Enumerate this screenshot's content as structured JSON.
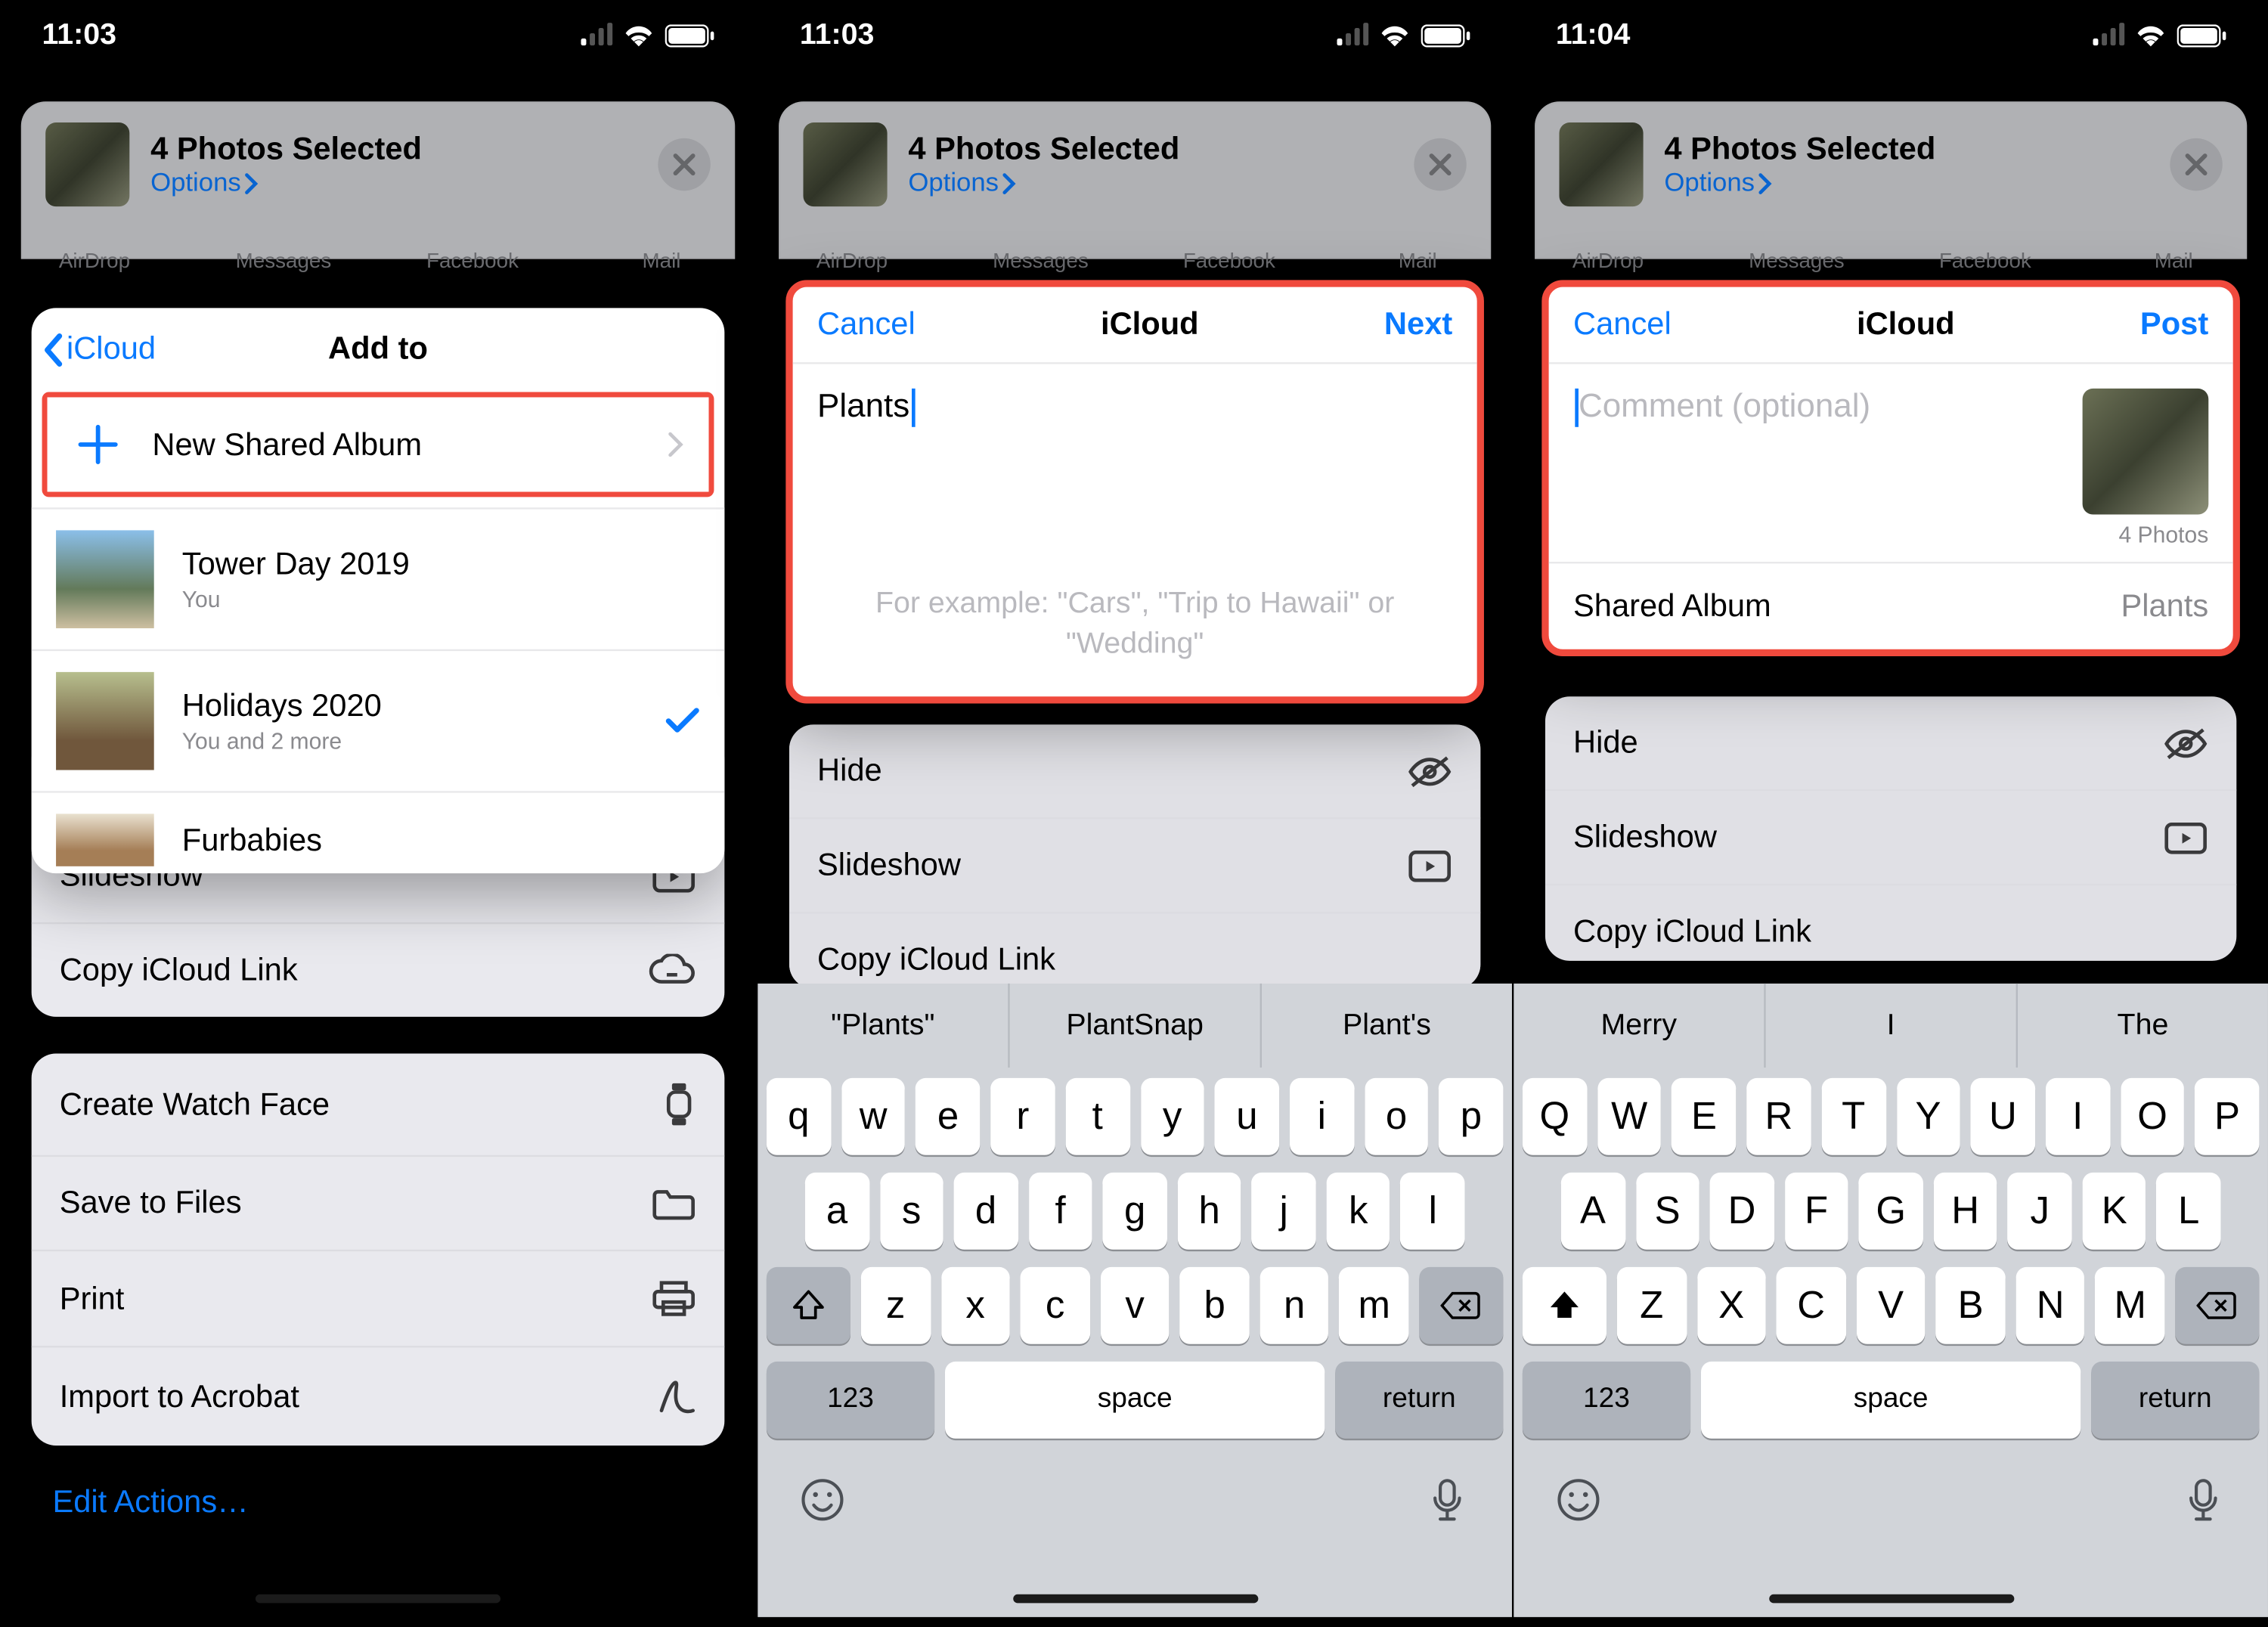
{
  "status": {
    "time_a": "11:03",
    "time_b": "11:03",
    "time_c": "11:04"
  },
  "share": {
    "title": "4 Photos Selected",
    "options_label": "Options",
    "apps": [
      "AirDrop",
      "Messages",
      "Facebook",
      "Mail"
    ]
  },
  "addto": {
    "back_label": "iCloud",
    "title": "Add to",
    "new_label": "New Shared Album",
    "albums": [
      {
        "title": "Tower Day 2019",
        "sub": "You",
        "selected": false
      },
      {
        "title": "Holidays 2020",
        "sub": "You and 2 more",
        "selected": true
      },
      {
        "title": "Furbabies",
        "sub": "",
        "selected": false
      }
    ]
  },
  "actions1": [
    "Hide",
    "Slideshow",
    "Copy iCloud Link"
  ],
  "actions2": [
    "Create Watch Face",
    "Save to Files",
    "Print",
    "Import to Acrobat"
  ],
  "edit_actions": "Edit Actions…",
  "actions_mid": [
    "Hide",
    "Slideshow",
    "Copy iCloud Link"
  ],
  "card2": {
    "cancel": "Cancel",
    "title": "iCloud",
    "next": "Next",
    "input": "Plants",
    "hint": "For example: \"Cars\", \"Trip to Hawaii\" or \"Wedding\""
  },
  "card3": {
    "cancel": "Cancel",
    "title": "iCloud",
    "post": "Post",
    "placeholder": "Comment (optional)",
    "count": "4 Photos",
    "row_label": "Shared Album",
    "row_value": "Plants"
  },
  "kb2": {
    "sugg": [
      "\"Plants\"",
      "PlantSnap",
      "Plant's"
    ],
    "rows": [
      [
        "q",
        "w",
        "e",
        "r",
        "t",
        "y",
        "u",
        "i",
        "o",
        "p"
      ],
      [
        "a",
        "s",
        "d",
        "f",
        "g",
        "h",
        "j",
        "k",
        "l"
      ],
      [
        "z",
        "x",
        "c",
        "v",
        "b",
        "n",
        "m"
      ]
    ],
    "num": "123",
    "space": "space",
    "return": "return"
  },
  "kb3": {
    "sugg": [
      "Merry",
      "I",
      "The"
    ],
    "rows": [
      [
        "Q",
        "W",
        "E",
        "R",
        "T",
        "Y",
        "U",
        "I",
        "O",
        "P"
      ],
      [
        "A",
        "S",
        "D",
        "F",
        "G",
        "H",
        "J",
        "K",
        "L"
      ],
      [
        "Z",
        "X",
        "C",
        "V",
        "B",
        "N",
        "M"
      ]
    ],
    "num": "123",
    "space": "space",
    "return": "return"
  }
}
